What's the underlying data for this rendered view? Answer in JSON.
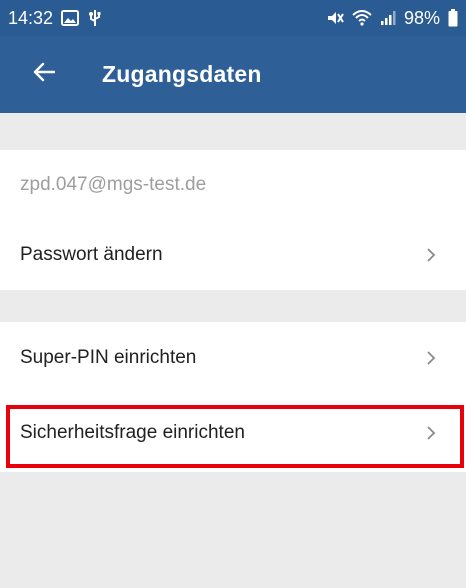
{
  "status_bar": {
    "time": "14:32",
    "battery": "98%",
    "icons": [
      "image-icon",
      "usb-icon",
      "mute-icon",
      "wifi-icon",
      "signal-icon",
      "battery-icon"
    ]
  },
  "app_bar": {
    "title": "Zugangsdaten",
    "back_icon": "arrow-left-icon",
    "color": "#2e5f96"
  },
  "account": {
    "email": "zpd.047@mgs-test.de",
    "change_password_label": "Passwort ändern"
  },
  "security": {
    "super_pin_label": "Super-PIN einrichten",
    "security_question_label": "Sicherheitsfrage einrichten"
  },
  "highlight_color": "#e8000b"
}
